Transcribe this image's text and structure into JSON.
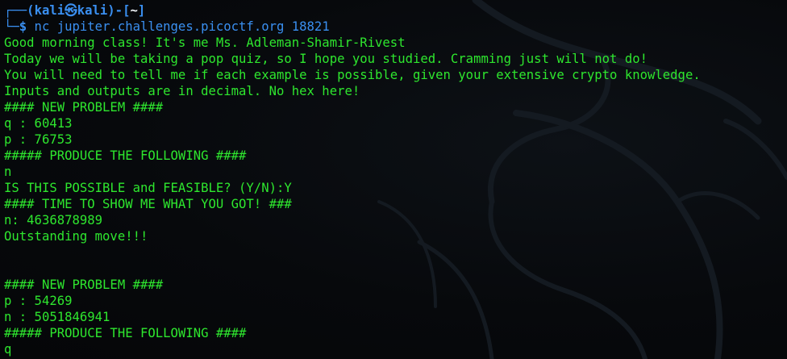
{
  "prompt": {
    "frame_top_left": "┌──(",
    "user": "kali",
    "at_symbol": "㉿",
    "host": "kali",
    "frame_mid": ")-[",
    "cwd": "~",
    "frame_end": "]",
    "frame_bottom_left": "└─",
    "dollar": "$",
    "command": " nc jupiter.challenges.picoctf.org 18821"
  },
  "output_lines": [
    "Good morning class! It's me Ms. Adleman-Shamir-Rivest",
    "Today we will be taking a pop quiz, so I hope you studied. Cramming just will not do!",
    "You will need to tell me if each example is possible, given your extensive crypto knowledge.",
    "Inputs and outputs are in decimal. No hex here!",
    "#### NEW PROBLEM ####",
    "q : 60413",
    "p : 76753",
    "##### PRODUCE THE FOLLOWING ####",
    "n",
    "IS THIS POSSIBLE and FEASIBLE? (Y/N):Y",
    "#### TIME TO SHOW ME WHAT YOU GOT! ###",
    "n: 4636878989",
    "Outstanding move!!!",
    "",
    "",
    "#### NEW PROBLEM ####",
    "p : 54269",
    "n : 5051846941",
    "##### PRODUCE THE FOLLOWING ####",
    "q"
  ],
  "colors": {
    "background": "#06080b",
    "output_green": "#2ee62e",
    "prompt_blue": "#3a8ff0",
    "prompt_white": "#e9eef2"
  }
}
